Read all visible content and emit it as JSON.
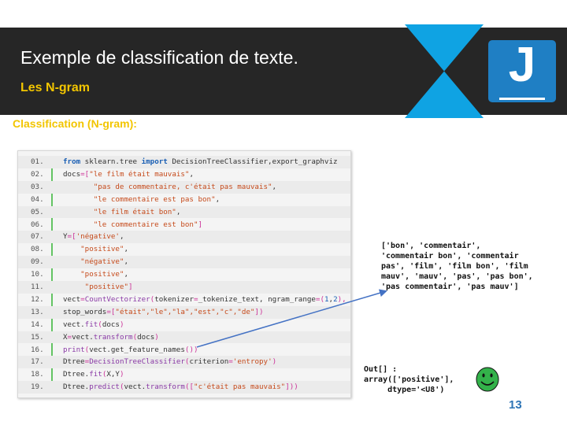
{
  "slide": {
    "title": "Exemple de classification de texte.",
    "subtitle": "Les N-gram",
    "section": "Classification (N-gram):",
    "page_number": "13",
    "logo_letter": "J"
  },
  "colors": {
    "header_bg": "#262626",
    "accent_yellow": "#f2c500",
    "accent_cyan": "#0fa3e3",
    "logo_blue": "#1f7fc4",
    "page_number": "#2e75b6",
    "smiley": "#33b24a"
  },
  "code": {
    "line_numbers": [
      "01.",
      "02.",
      "03.",
      "04.",
      "05.",
      "06.",
      "07.",
      "08.",
      "09.",
      "10.",
      "11.",
      "12.",
      "13.",
      "14.",
      "15.",
      "16.",
      "17.",
      "18.",
      "19."
    ],
    "lines": [
      [
        {
          "t": "from",
          "c": "kw"
        },
        {
          "t": " sklearn.tree ",
          "c": ""
        },
        {
          "t": "import",
          "c": "kw"
        },
        {
          "t": " DecisionTreeClassifier,export_graphviz",
          "c": ""
        }
      ],
      [
        {
          "t": "docs",
          "c": ""
        },
        {
          "t": "=[",
          "c": "op"
        },
        {
          "t": "\"le film était mauvais\"",
          "c": "str"
        },
        {
          "t": ",",
          "c": ""
        }
      ],
      [
        {
          "t": "       ",
          "c": ""
        },
        {
          "t": "\"pas de commentaire, c'était pas mauvais\"",
          "c": "str"
        },
        {
          "t": ",",
          "c": ""
        }
      ],
      [
        {
          "t": "       ",
          "c": ""
        },
        {
          "t": "\"le commentaire est pas bon\"",
          "c": "str"
        },
        {
          "t": ",",
          "c": ""
        }
      ],
      [
        {
          "t": "       ",
          "c": ""
        },
        {
          "t": "\"le film était bon\"",
          "c": "str"
        },
        {
          "t": ",",
          "c": ""
        }
      ],
      [
        {
          "t": "       ",
          "c": ""
        },
        {
          "t": "\"le commentaire est bon\"",
          "c": "str"
        },
        {
          "t": "]",
          "c": "op"
        }
      ],
      [
        {
          "t": "Y",
          "c": ""
        },
        {
          "t": "=[",
          "c": "op"
        },
        {
          "t": "'négative'",
          "c": "str"
        },
        {
          "t": ",",
          "c": ""
        }
      ],
      [
        {
          "t": "    ",
          "c": ""
        },
        {
          "t": "\"positive\"",
          "c": "str"
        },
        {
          "t": ",",
          "c": ""
        }
      ],
      [
        {
          "t": "    ",
          "c": ""
        },
        {
          "t": "\"négative\"",
          "c": "str"
        },
        {
          "t": ",",
          "c": ""
        }
      ],
      [
        {
          "t": "    ",
          "c": ""
        },
        {
          "t": "\"positive\"",
          "c": "str"
        },
        {
          "t": ",",
          "c": ""
        }
      ],
      [
        {
          "t": "     ",
          "c": ""
        },
        {
          "t": "\"positive\"",
          "c": "str"
        },
        {
          "t": "]",
          "c": "op"
        }
      ],
      [
        {
          "t": "vect",
          "c": ""
        },
        {
          "t": "=",
          "c": "op"
        },
        {
          "t": "CountVectorizer",
          "c": "fn"
        },
        {
          "t": "(",
          "c": "op"
        },
        {
          "t": "tokenizer",
          "c": ""
        },
        {
          "t": "=",
          "c": "op"
        },
        {
          "t": "_tokenize_text, ngram_range",
          "c": ""
        },
        {
          "t": "=(",
          "c": "op"
        },
        {
          "t": "1",
          "c": "num"
        },
        {
          "t": ",",
          "c": ""
        },
        {
          "t": "2",
          "c": "num"
        },
        {
          "t": "),",
          "c": "op"
        }
      ],
      [
        {
          "t": "stop_words",
          "c": ""
        },
        {
          "t": "=[",
          "c": "op"
        },
        {
          "t": "\"était\",\"le\",\"la\",\"est\",\"c\",\"de\"",
          "c": "str"
        },
        {
          "t": "])",
          "c": "op"
        }
      ],
      [
        {
          "t": "vect.",
          "c": ""
        },
        {
          "t": "fit",
          "c": "fn"
        },
        {
          "t": "(",
          "c": "op"
        },
        {
          "t": "docs",
          "c": ""
        },
        {
          "t": ")",
          "c": "op"
        }
      ],
      [
        {
          "t": "X",
          "c": ""
        },
        {
          "t": "=",
          "c": "op"
        },
        {
          "t": "vect.",
          "c": ""
        },
        {
          "t": "transform",
          "c": "fn"
        },
        {
          "t": "(",
          "c": "op"
        },
        {
          "t": "docs",
          "c": ""
        },
        {
          "t": ")",
          "c": "op"
        }
      ],
      [
        {
          "t": "print",
          "c": "fn"
        },
        {
          "t": "(",
          "c": "op"
        },
        {
          "t": "vect.get_feature_names",
          "c": ""
        },
        {
          "t": "())",
          "c": "op"
        }
      ],
      [
        {
          "t": "Dtree",
          "c": ""
        },
        {
          "t": "=",
          "c": "op"
        },
        {
          "t": "DecisionTreeClassifier",
          "c": "fn"
        },
        {
          "t": "(",
          "c": "op"
        },
        {
          "t": "criterion",
          "c": ""
        },
        {
          "t": "=",
          "c": "op"
        },
        {
          "t": "'entropy'",
          "c": "str"
        },
        {
          "t": ")",
          "c": "op"
        }
      ],
      [
        {
          "t": "Dtree.",
          "c": ""
        },
        {
          "t": "fit",
          "c": "fn"
        },
        {
          "t": "(",
          "c": "op"
        },
        {
          "t": "X,Y",
          "c": ""
        },
        {
          "t": ")",
          "c": "op"
        }
      ],
      [
        {
          "t": "Dtree.",
          "c": ""
        },
        {
          "t": "predict",
          "c": "fn"
        },
        {
          "t": "(",
          "c": "op"
        },
        {
          "t": "vect.",
          "c": ""
        },
        {
          "t": "transform",
          "c": "fn"
        },
        {
          "t": "([",
          "c": "op"
        },
        {
          "t": "\"c'était pas mauvais\"",
          "c": "str"
        },
        {
          "t": "]))",
          "c": "op"
        }
      ]
    ]
  },
  "output_features": "['bon', 'commentair',\n'commentair bon', 'commentair\npas', 'film', 'film bon', 'film\nmauv', 'mauv', 'pas', 'pas bon',\n'pas commentair', 'pas mauv']",
  "output_predict": "Out[] :\narray(['positive'],\n     dtype='<U8')",
  "icons": {
    "logo": "j-logo-icon",
    "arrow": "arrow-icon",
    "smiley": "smiley-icon",
    "hourglass": "hourglass-decoration"
  }
}
